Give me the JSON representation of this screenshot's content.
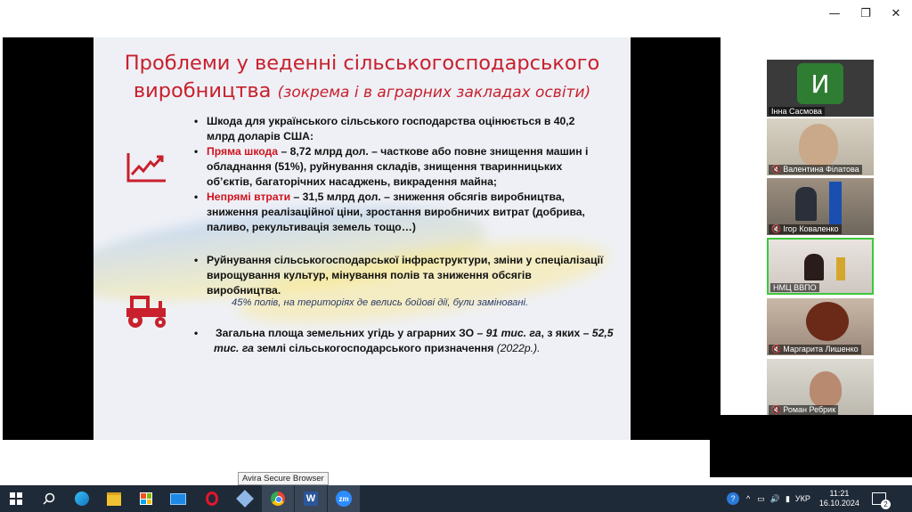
{
  "slide": {
    "title_line1": "Проблеми у веденні сільськогосподарського",
    "title_line2": "виробництва",
    "title_sub": "(зокрема і в аграрних закладах освіти)",
    "bullet1": "Шкода для українського сільського господарства оцінюється в 40,2 млрд доларів США:",
    "bullet2_red": "Пряма шкода",
    "bullet2_rest": " – 8,72 млрд дол. – часткове або повне знищення машин і обладнання (51%), руйнування складів, знищення тваринницьких об’єктів, багаторічних насаджень, викрадення майна;",
    "bullet3_red": "Непрямі втрати",
    "bullet3_rest": " – 31,5 млрд дол. – зниження обсягів виробництва, зниження реалізаційної ціни, зростання виробничих витрат (добрива, паливо, рекультивація земель тощо…)",
    "bullet4": "Руйнування сільськогосподарської інфраструктури, зміни у спеціалізації вирощування культур,  мінування полів та зниження обсягів виробництва.",
    "note": "45% полів, на територіях де велись бойові дії, були заміновані.",
    "bullet5_a": "Загальна площа земельних угідь у аграрних ЗО – ",
    "bullet5_b": "91 тис. га",
    "bullet5_c": ", з яких – ",
    "bullet5_d": "52,5 тис. га",
    "bullet5_e": " землі сільськогосподарського призначення ",
    "bullet5_f": "(2022р.).",
    "bullet_char": "•",
    "colors": {
      "title_red": "#c8202c",
      "icon_red": "#c8202c"
    }
  },
  "participants": [
    {
      "name": "Інна Сасмова",
      "initial": "И"
    },
    {
      "name": "Валентина Філатова"
    },
    {
      "name": "Ігор Коваленко"
    },
    {
      "name": "НМЦ ВВПО"
    },
    {
      "name": "Маргарита Лишенко"
    },
    {
      "name": "Роман Ребрик"
    }
  ],
  "tooltip": "Avira Secure Browser",
  "window_controls": {
    "minimize": "—",
    "maximize": "❐",
    "close": "✕"
  },
  "taskbar": {
    "apps": [
      "start-icon",
      "search-icon",
      "edge-icon",
      "file-explorer-icon",
      "store-icon",
      "mail-icon",
      "opera-icon",
      "network-icon",
      "chrome-icon",
      "word-icon",
      "zoom-icon"
    ],
    "word_letter": "W",
    "zoom_label": "zm",
    "tray_lang": "УКР",
    "time": "11:21",
    "date": "16.10.2024",
    "notif_count": "2",
    "help": "?",
    "chevron": "^"
  }
}
